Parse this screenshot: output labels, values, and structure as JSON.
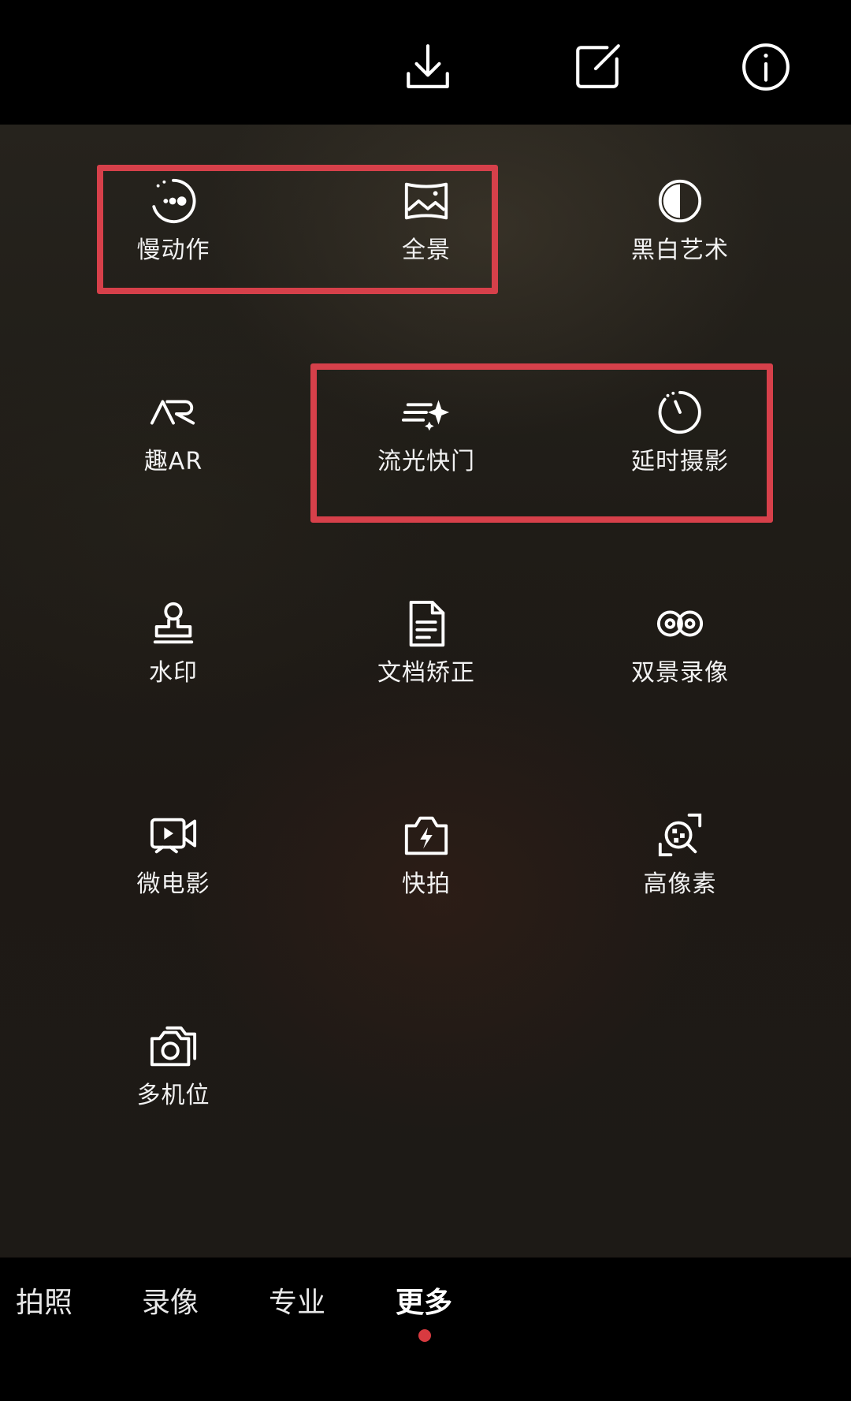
{
  "topbar": {
    "icons": [
      "download-icon",
      "edit-icon",
      "info-icon"
    ]
  },
  "modes": [
    {
      "label": "慢动作",
      "icon": "slow-motion-icon"
    },
    {
      "label": "全景",
      "icon": "panorama-icon"
    },
    {
      "label": "黑白艺术",
      "icon": "monochrome-icon"
    },
    {
      "label": "趣AR",
      "icon": "ar-icon"
    },
    {
      "label": "流光快门",
      "icon": "light-trail-icon"
    },
    {
      "label": "延时摄影",
      "icon": "timelapse-icon"
    },
    {
      "label": "水印",
      "icon": "watermark-icon"
    },
    {
      "label": "文档矫正",
      "icon": "document-icon"
    },
    {
      "label": "双景录像",
      "icon": "dual-view-icon"
    },
    {
      "label": "微电影",
      "icon": "micro-movie-icon"
    },
    {
      "label": "快拍",
      "icon": "quick-snap-icon"
    },
    {
      "label": "高像素",
      "icon": "high-res-icon"
    },
    {
      "label": "多机位",
      "icon": "multi-camera-icon"
    }
  ],
  "tabs": [
    {
      "label": "拍照"
    },
    {
      "label": "录像"
    },
    {
      "label": "专业"
    },
    {
      "label": "更多",
      "active": true
    }
  ],
  "colors": {
    "highlight": "#d6404a",
    "active_dot": "#d83a40"
  }
}
